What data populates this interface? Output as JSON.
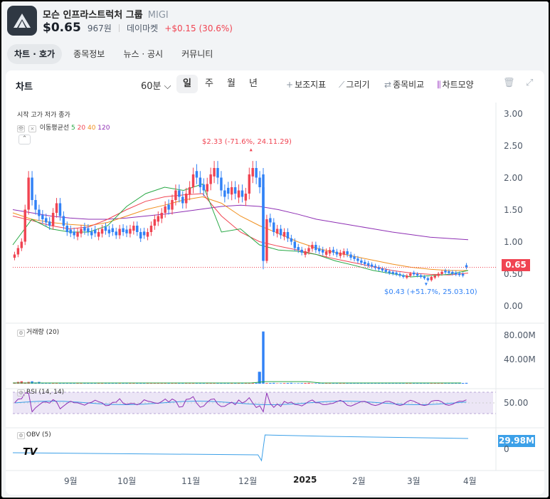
{
  "header": {
    "company_name": "모슨 인프라스트럭처 그룹",
    "ticker": "MIGI",
    "price_usd": "$0.65",
    "price_krw": "967원",
    "source": "데이마켓",
    "change": "+$0.15 (30.6%)"
  },
  "tabs": [
    {
      "label": "차트 · 호가",
      "active": true
    },
    {
      "label": "종목정보",
      "active": false
    },
    {
      "label": "뉴스 · 공시",
      "active": false
    },
    {
      "label": "커뮤니티",
      "active": false
    }
  ],
  "toolbar": {
    "title": "차트",
    "interval": "60분",
    "periods": [
      "일",
      "주",
      "월",
      "년"
    ],
    "active_period": "일",
    "tools": [
      "보조지표",
      "그리기",
      "종목비교",
      "차트모양"
    ]
  },
  "legend": {
    "ohlc": "시작  고가  저가  종가",
    "ma_label": "이동평균선",
    "ma_periods": [
      "5",
      "20",
      "40",
      "120"
    ],
    "ma_colors": [
      "#27a844",
      "#f04452",
      "#f0901f",
      "#8e2fb4"
    ],
    "volume": "거래량 (20)",
    "rsi": "RSI (14, 14)",
    "obv": "OBV (5)"
  },
  "colors": {
    "up": "#f04452",
    "down": "#3182f6",
    "volume_ma": "#27a844",
    "rsi_line": "#8e2fb4",
    "rsi_signal": "#3ca0e8",
    "obv_line": "#3ca0e8"
  },
  "annotations": {
    "high": "$2.33 (-71.6%, 24.11.29)",
    "low": "$0.43 (+51.7%, 25.03.10)"
  },
  "price_axis": [
    "3.00",
    "2.50",
    "2.00",
    "1.50",
    "1.00",
    "0.50",
    "0.00"
  ],
  "current_price_badge": "0.65",
  "volume_axis": [
    "80.00M",
    "40.00M"
  ],
  "rsi_axis": [
    "50.00"
  ],
  "obv_axis": [
    "0"
  ],
  "obv_badge": "29.98M",
  "x_axis": [
    "9월",
    "10월",
    "11월",
    "12월",
    "2025",
    "2월",
    "3월",
    "4월"
  ],
  "chart_data": {
    "type": "candlestick",
    "price_range": [
      0,
      3.0
    ],
    "closes": [
      0.85,
      0.95,
      1.05,
      1.55,
      2.05,
      1.7,
      1.55,
      1.45,
      1.4,
      1.35,
      1.3,
      1.5,
      1.65,
      1.45,
      1.3,
      1.2,
      1.18,
      1.15,
      1.2,
      1.25,
      1.22,
      1.2,
      1.15,
      1.18,
      1.2,
      1.25,
      1.22,
      1.18,
      1.2,
      1.15,
      1.25,
      1.2,
      1.18,
      1.25,
      1.3,
      1.2,
      1.1,
      1.15,
      1.2,
      1.3,
      1.4,
      1.45,
      1.5,
      1.6,
      1.55,
      1.7,
      1.85,
      1.75,
      1.65,
      1.8,
      1.9,
      2.1,
      2.05,
      1.9,
      1.85,
      1.95,
      2.1,
      2.2,
      2.05,
      1.85,
      1.75,
      1.8,
      1.9,
      1.8,
      1.85,
      1.75,
      1.8,
      2.1,
      2.2,
      2.05,
      1.9,
      0.75,
      1.4,
      1.35,
      1.2,
      1.25,
      1.15,
      1.2,
      1.1,
      1.05,
      0.95,
      0.92,
      0.88,
      0.9,
      0.95,
      1.0,
      0.92,
      0.9,
      0.88,
      0.9,
      0.92,
      0.88,
      0.85,
      0.88,
      0.9,
      0.85,
      0.8,
      0.78,
      0.75,
      0.72,
      0.7,
      0.68,
      0.66,
      0.64,
      0.62,
      0.6,
      0.58,
      0.56,
      0.55,
      0.54,
      0.52,
      0.5,
      0.52,
      0.55,
      0.54,
      0.52,
      0.5,
      0.48,
      0.45,
      0.5,
      0.52,
      0.55,
      0.58,
      0.57,
      0.56,
      0.55,
      0.54,
      0.53,
      0.52,
      0.65
    ],
    "up_days": [
      0,
      1,
      2,
      3,
      4,
      11,
      12,
      18,
      19,
      24,
      25,
      30,
      33,
      34,
      38,
      39,
      40,
      41,
      42,
      43,
      45,
      46,
      49,
      50,
      51,
      55,
      56,
      57,
      62,
      64,
      66,
      67,
      68,
      72,
      75,
      77,
      83,
      84,
      85,
      89,
      90,
      93,
      94,
      112,
      113,
      119,
      120,
      121,
      122,
      130
    ],
    "ma": [
      {
        "period": 120,
        "values": [
          1.55,
          1.5,
          1.45,
          1.42,
          1.4,
          1.4,
          1.42,
          1.45,
          1.48,
          1.52,
          1.56,
          1.6,
          1.62,
          1.6,
          1.55,
          1.48,
          1.4,
          1.35,
          1.3,
          1.25,
          1.2,
          1.16,
          1.12,
          1.1,
          1.08
        ]
      },
      {
        "period": 40,
        "values": [
          1.5,
          1.4,
          1.35,
          1.32,
          1.3,
          1.35,
          1.45,
          1.55,
          1.62,
          1.7,
          1.75,
          1.65,
          1.45,
          1.3,
          1.18,
          1.05,
          0.95,
          0.88,
          0.82,
          0.76,
          0.7,
          0.65,
          0.62,
          0.6,
          0.6
        ]
      },
      {
        "period": 20,
        "values": [
          1.45,
          1.38,
          1.3,
          1.25,
          1.28,
          1.4,
          1.55,
          1.68,
          1.75,
          1.78,
          1.8,
          1.45,
          1.2,
          1.05,
          0.98,
          0.92,
          0.85,
          0.78,
          0.72,
          0.66,
          0.6,
          0.56,
          0.54,
          0.53,
          0.56
        ]
      },
      {
        "period": 5,
        "values": [
          1.0,
          1.4,
          1.25,
          1.2,
          1.2,
          1.3,
          1.6,
          1.8,
          1.9,
          1.85,
          1.95,
          1.2,
          1.25,
          1.0,
          0.92,
          0.9,
          0.85,
          0.75,
          0.68,
          0.6,
          0.55,
          0.5,
          0.52,
          0.54,
          0.6
        ]
      }
    ],
    "volume_spikes_millions": [
      {
        "day": 71,
        "value": 88
      },
      {
        "day": 70,
        "value": 20
      }
    ],
    "rsi_level": 50,
    "obv_end_millions": 29.98
  }
}
